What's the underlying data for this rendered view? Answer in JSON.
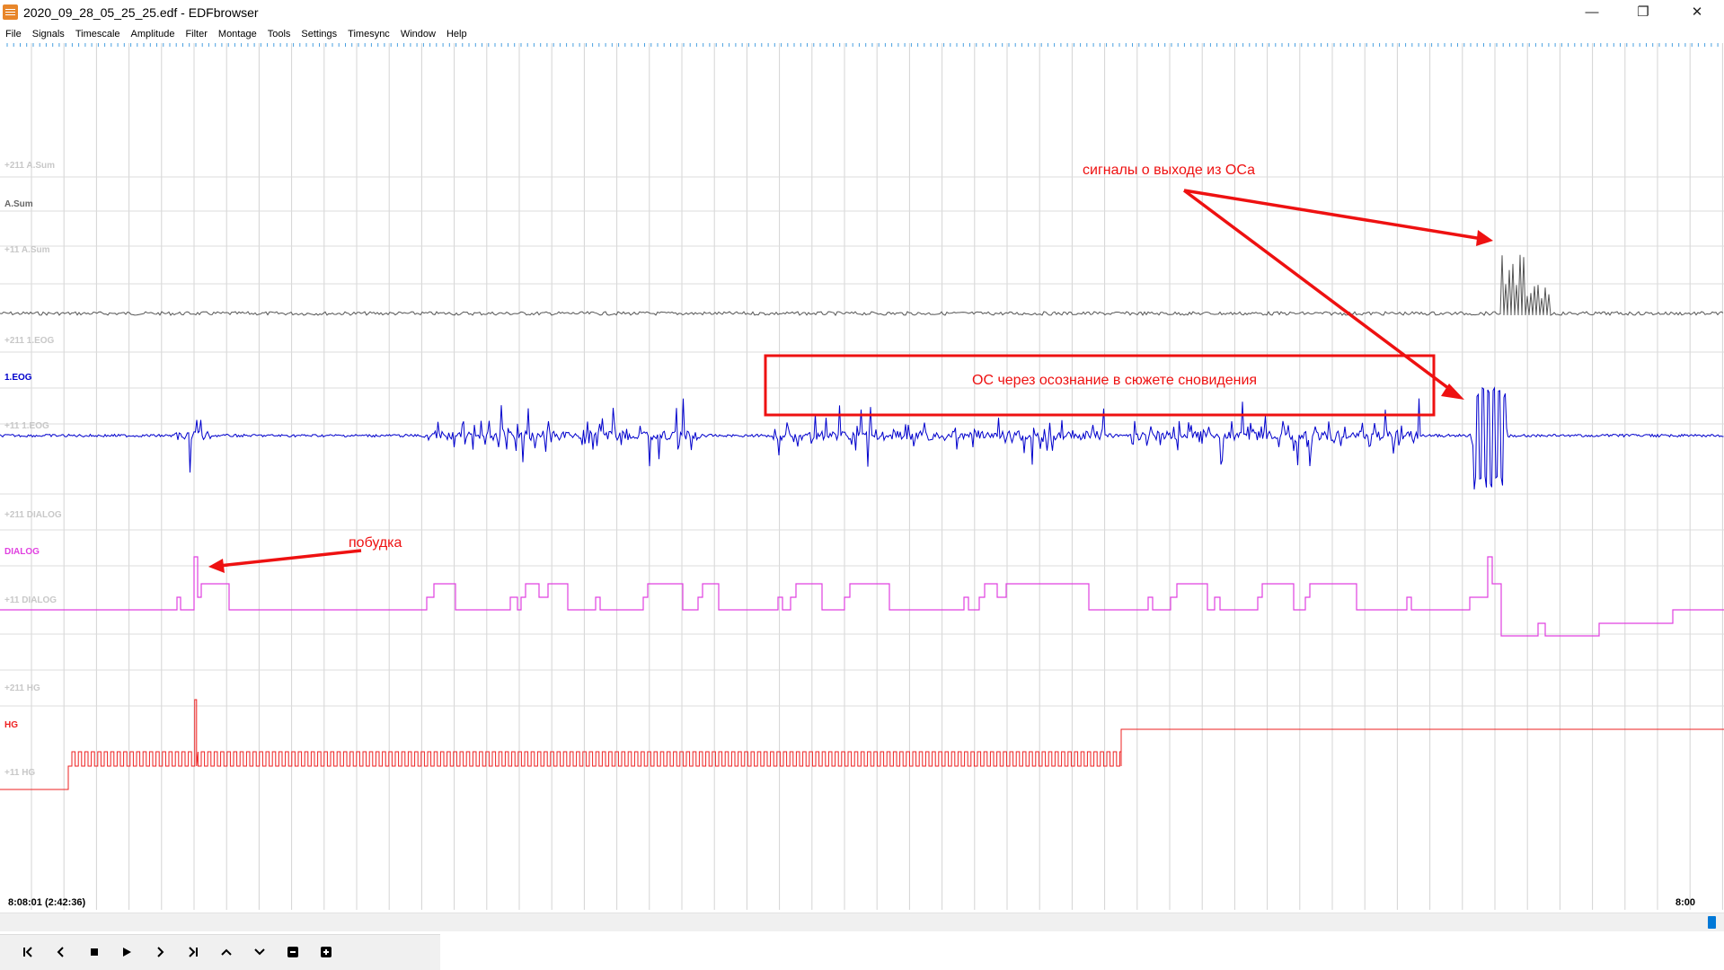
{
  "window": {
    "title": "2020_09_28_05_25_25.edf - EDFbrowser",
    "minimize": "—",
    "maximize": "❐",
    "close": "✕"
  },
  "menu": [
    "File",
    "Signals",
    "Timescale",
    "Amplitude",
    "Filter",
    "Montage",
    "Tools",
    "Settings",
    "Timesync",
    "Window",
    "Help"
  ],
  "signals": [
    {
      "label": "A.Sum",
      "top": "+211 A.Sum",
      "bottom": "+11 A.Sum",
      "color": "#555555"
    },
    {
      "label": "1.EOG",
      "top": "+211 1.EOG",
      "bottom": "+11 1.EOG",
      "color": "#0000cc"
    },
    {
      "label": "DIALOG",
      "top": "+211 DIALOG",
      "bottom": "+11 DIALOG",
      "color": "#e040e0"
    },
    {
      "label": "HG",
      "top": "+211 HG",
      "bottom": "+11 HG",
      "color": "#ee2222"
    }
  ],
  "annotations": {
    "exit": "сигналы о выходе из ОСа",
    "lucid": "ОС через осознание в сюжете сновидения",
    "wake": "побудка",
    "color": "#ee1111"
  },
  "time": {
    "left": "8:08:01 (2:42:36)",
    "right": "8:00"
  },
  "toolbar_icons": [
    "skip-back-icon",
    "prev-icon",
    "stop-icon",
    "play-icon",
    "next-icon",
    "skip-forward-icon",
    "amplitude-up-icon",
    "amplitude-down-icon",
    "zoom-out-icon",
    "zoom-in-icon"
  ]
}
